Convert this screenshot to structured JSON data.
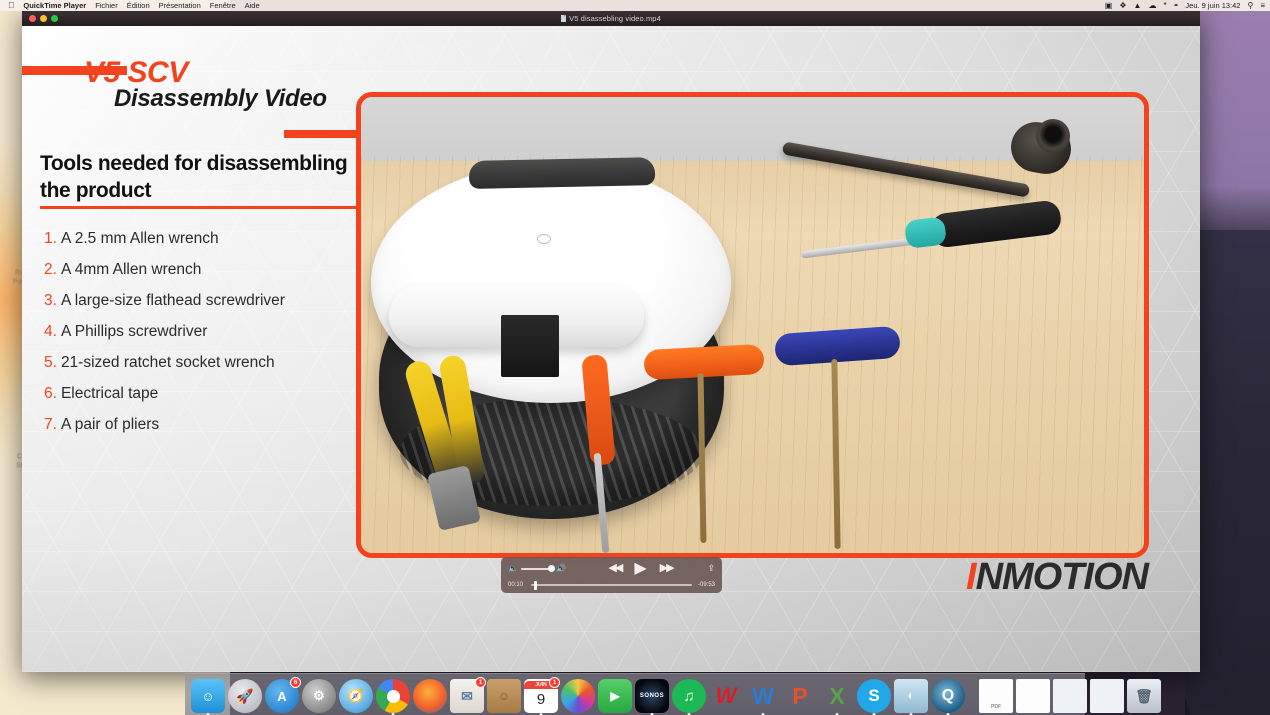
{
  "menubar": {
    "apple_icon": "apple-logo",
    "app_name": "QuickTime Player",
    "items": [
      "Fichier",
      "Édition",
      "Présentation",
      "Fenêtre",
      "Aide"
    ],
    "status_icons": [
      "screen-recording-icon",
      "dropbox-icon",
      "notification-bell-icon",
      "cloud-icon",
      "bluetooth-icon",
      "wifi-icon"
    ],
    "clock": "Jeu. 9 juin  13:42",
    "search_icon": "search-icon",
    "control_center_icon": "list-icon"
  },
  "window": {
    "title": "V5 disassebling video.mp4",
    "traffic_lights": [
      "close-button",
      "minimize-button",
      "zoom-button"
    ]
  },
  "slide": {
    "title_main": "V5 SCV",
    "title_sub": "Disassembly Video",
    "heading": "Tools needed for disassembling the product",
    "tools": [
      {
        "num": "1.",
        "text": "A 2.5 mm Allen wrench"
      },
      {
        "num": "2.",
        "text": "A 4mm Allen wrench"
      },
      {
        "num": "3.",
        "text": "A large-size flathead screwdriver"
      },
      {
        "num": "4.",
        "text": "A Phillips screwdriver"
      },
      {
        "num": "5.",
        "text": "21-sized ratchet socket wrench"
      },
      {
        "num": "6.",
        "text": "Electrical tape"
      },
      {
        "num": "7.",
        "text": "A pair of pliers"
      }
    ],
    "logo_first_letter": "I",
    "logo_rest": "NMOTION",
    "accent_color": "#f4421e",
    "photo_alt": "white electric unicycle and tools on wooden table"
  },
  "controls": {
    "volume_icon_low": "speaker-low-icon",
    "volume_icon_high": "speaker-high-icon",
    "rewind_icon": "rewind-icon",
    "play_icon": "play-icon",
    "forward_icon": "fast-forward-icon",
    "share_icon": "share-icon",
    "elapsed_time": "00:10",
    "remaining_time": "-09:53"
  },
  "desktop": {
    "icon_labels": [
      "Re…\nPols…",
      "C…\nSt…"
    ]
  },
  "dock": {
    "items": [
      {
        "name": "finder",
        "glyph": "☺",
        "badge": "",
        "running": true
      },
      {
        "name": "launchpad",
        "glyph": "🚀",
        "badge": "",
        "running": false
      },
      {
        "name": "app-store",
        "glyph": "A",
        "badge": "6",
        "running": false
      },
      {
        "name": "system-preferences",
        "glyph": "⚙",
        "badge": "",
        "running": false
      },
      {
        "name": "safari",
        "glyph": "🧭",
        "badge": "",
        "running": false
      },
      {
        "name": "chrome",
        "glyph": "◉",
        "badge": "",
        "running": true
      },
      {
        "name": "firefox",
        "glyph": "🦊",
        "badge": "",
        "running": false
      },
      {
        "name": "mail",
        "glyph": "✉",
        "badge": "1",
        "running": false
      },
      {
        "name": "contacts",
        "glyph": "▤",
        "badge": "",
        "running": false
      },
      {
        "name": "calendar",
        "glyph": "9",
        "badge": "1",
        "running": true
      },
      {
        "name": "photos",
        "glyph": "✿",
        "badge": "",
        "running": false
      },
      {
        "name": "facetime",
        "glyph": "▣",
        "badge": "",
        "running": false
      },
      {
        "name": "sonos",
        "glyph": "SONOS",
        "badge": "",
        "running": true
      },
      {
        "name": "spotify",
        "glyph": "♫",
        "badge": "",
        "running": true
      },
      {
        "name": "winamax",
        "glyph": "W",
        "badge": "",
        "running": false
      },
      {
        "name": "microsoft-word",
        "glyph": "W",
        "badge": "",
        "running": true
      },
      {
        "name": "microsoft-powerpoint",
        "glyph": "P",
        "badge": "",
        "running": false
      },
      {
        "name": "microsoft-excel",
        "glyph": "X",
        "badge": "",
        "running": true
      },
      {
        "name": "skype",
        "glyph": "S",
        "badge": "",
        "running": true
      },
      {
        "name": "preview",
        "glyph": "🖼",
        "badge": "",
        "running": true
      },
      {
        "name": "quicktime-player",
        "glyph": "Q",
        "badge": "",
        "running": true
      }
    ],
    "files": [
      {
        "name": "pdf-document",
        "glyph": "PDF"
      },
      {
        "name": "text-document",
        "glyph": ""
      },
      {
        "name": "window-thumbnail-1",
        "glyph": ""
      },
      {
        "name": "window-thumbnail-2",
        "glyph": ""
      }
    ],
    "trash": {
      "name": "trash",
      "glyph": "🗑"
    }
  }
}
